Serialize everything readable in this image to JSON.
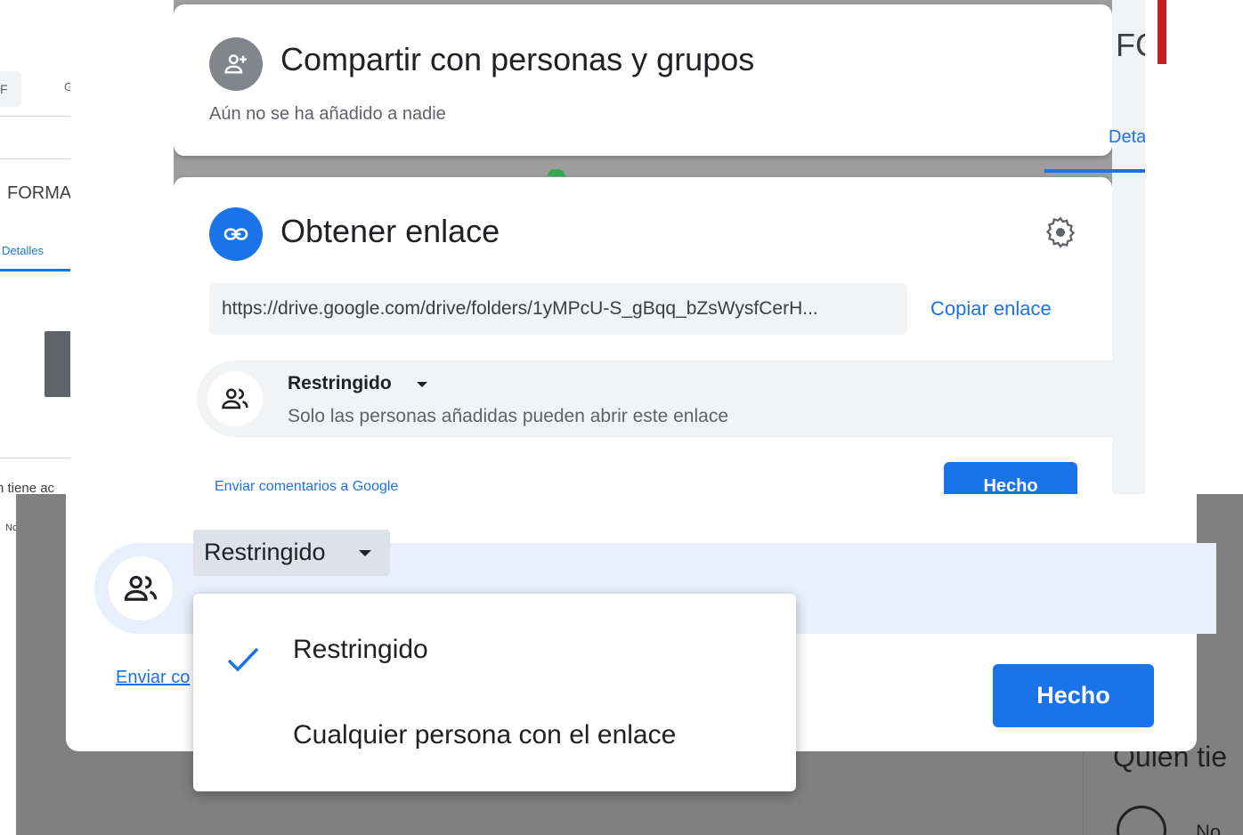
{
  "background": {
    "left_chip_text": "F",
    "left_g_text": "G",
    "left_title": "FORMA",
    "left_tab_details": "Detalles",
    "left_access_text": "n tiene ac",
    "left_no_text": "No",
    "right_title_fragment": "FC",
    "right_tab_fragment": "Deta"
  },
  "share_card": {
    "icon": "person-add-icon",
    "title": "Compartir con personas y grupos",
    "subtitle": "Aún no se ha añadido a nadie"
  },
  "link_card": {
    "icon": "link-icon",
    "title": "Obtener enlace",
    "settings_icon": "gear-icon",
    "url": "https://drive.google.com/drive/folders/1yMPcU-S_gBqq_bZsWysfCerH...",
    "copy_label": "Copiar enlace",
    "access_icon": "people-icon",
    "access_level": "Restringido",
    "access_description": "Solo las personas añadidas pueden abrir este enlace",
    "feedback_label": "Enviar comentarios a Google",
    "done_label": "Hecho"
  },
  "zoomed_view": {
    "access_level": "Restringido",
    "feedback_label": "Enviar co",
    "done_label": "Hecho",
    "who_has_access": "Quién tie",
    "who_no_text": "No",
    "dropdown_options": [
      {
        "label": "Restringido",
        "selected": true
      },
      {
        "label": "Cualquier persona con el enlace",
        "selected": false
      }
    ]
  },
  "colors": {
    "accent": "#1a73e8",
    "overlay": "#808080",
    "brand_red": "#c5221f"
  }
}
